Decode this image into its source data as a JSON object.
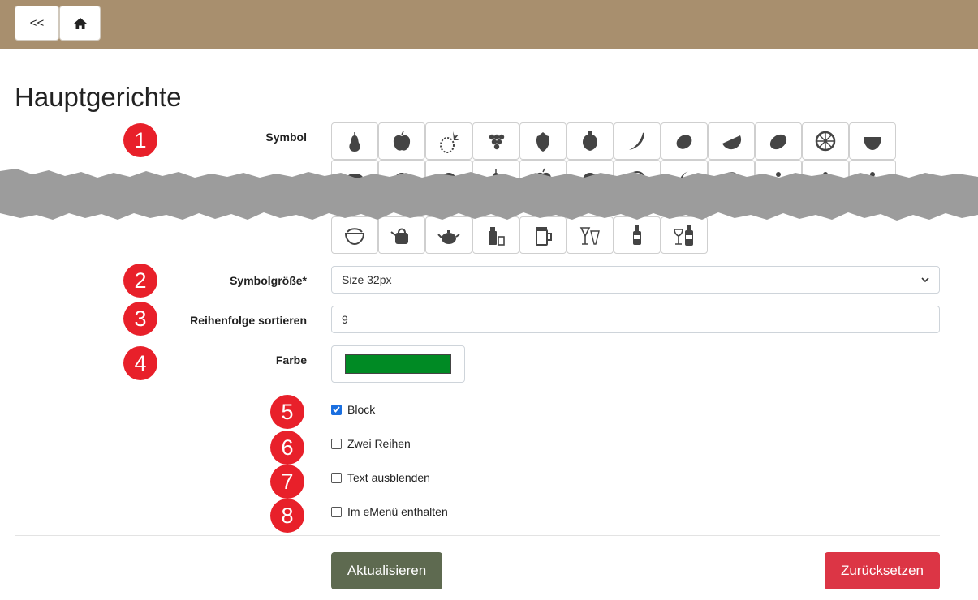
{
  "header": {
    "back_label": "<<",
    "home_icon": "home-icon"
  },
  "page": {
    "title": "Hauptgerichte"
  },
  "badges": [
    "1",
    "2",
    "3",
    "4",
    "5",
    "6",
    "7",
    "8"
  ],
  "form": {
    "symbol_label": "Symbol",
    "symbol_icons_row1": [
      "pear-icon",
      "apple-icon",
      "pineapple-icon",
      "grapes-icon",
      "strawberry-icon",
      "quince-icon",
      "chili-icon",
      "lemon-icon",
      "melon-slice-icon",
      "cucumber-icon",
      "citrus-slice-icon",
      "pitaya-icon"
    ],
    "symbol_icons_row2_partial": [
      "coconut-icon",
      "orange-icon",
      "tomato-icon",
      "pear-icon",
      "apple-icon",
      "herb-icon",
      "cabbage-icon",
      "banana-icon",
      "avocado-icon",
      "cake-icon",
      "cake-icon",
      "cake-icon"
    ],
    "symbol_icons_row3": [
      "bowl-icon",
      "kettle-icon",
      "teapot-icon",
      "milk-icon",
      "beer-mug-icon",
      "cocktail-icon",
      "bottle-icon",
      "wine-icon"
    ],
    "size_label": "Symbolgröße*",
    "size_value": "Size 32px",
    "sort_label": "Reihenfolge sortieren",
    "sort_value": "9",
    "color_label": "Farbe",
    "color_value": "#008a24",
    "checkboxes": [
      {
        "label": "Block",
        "checked": true
      },
      {
        "label": "Zwei Reihen",
        "checked": false
      },
      {
        "label": "Text ausblenden",
        "checked": false
      },
      {
        "label": "Im eMenü enthalten",
        "checked": false
      }
    ]
  },
  "actions": {
    "update_label": "Aktualisieren",
    "reset_label": "Zurücksetzen"
  },
  "colors": {
    "header_bg": "#a88f6e",
    "badge": "#e8202a",
    "update_btn": "#5e6a50",
    "reset_btn": "#dc3545",
    "icon_fill": "#444444"
  }
}
